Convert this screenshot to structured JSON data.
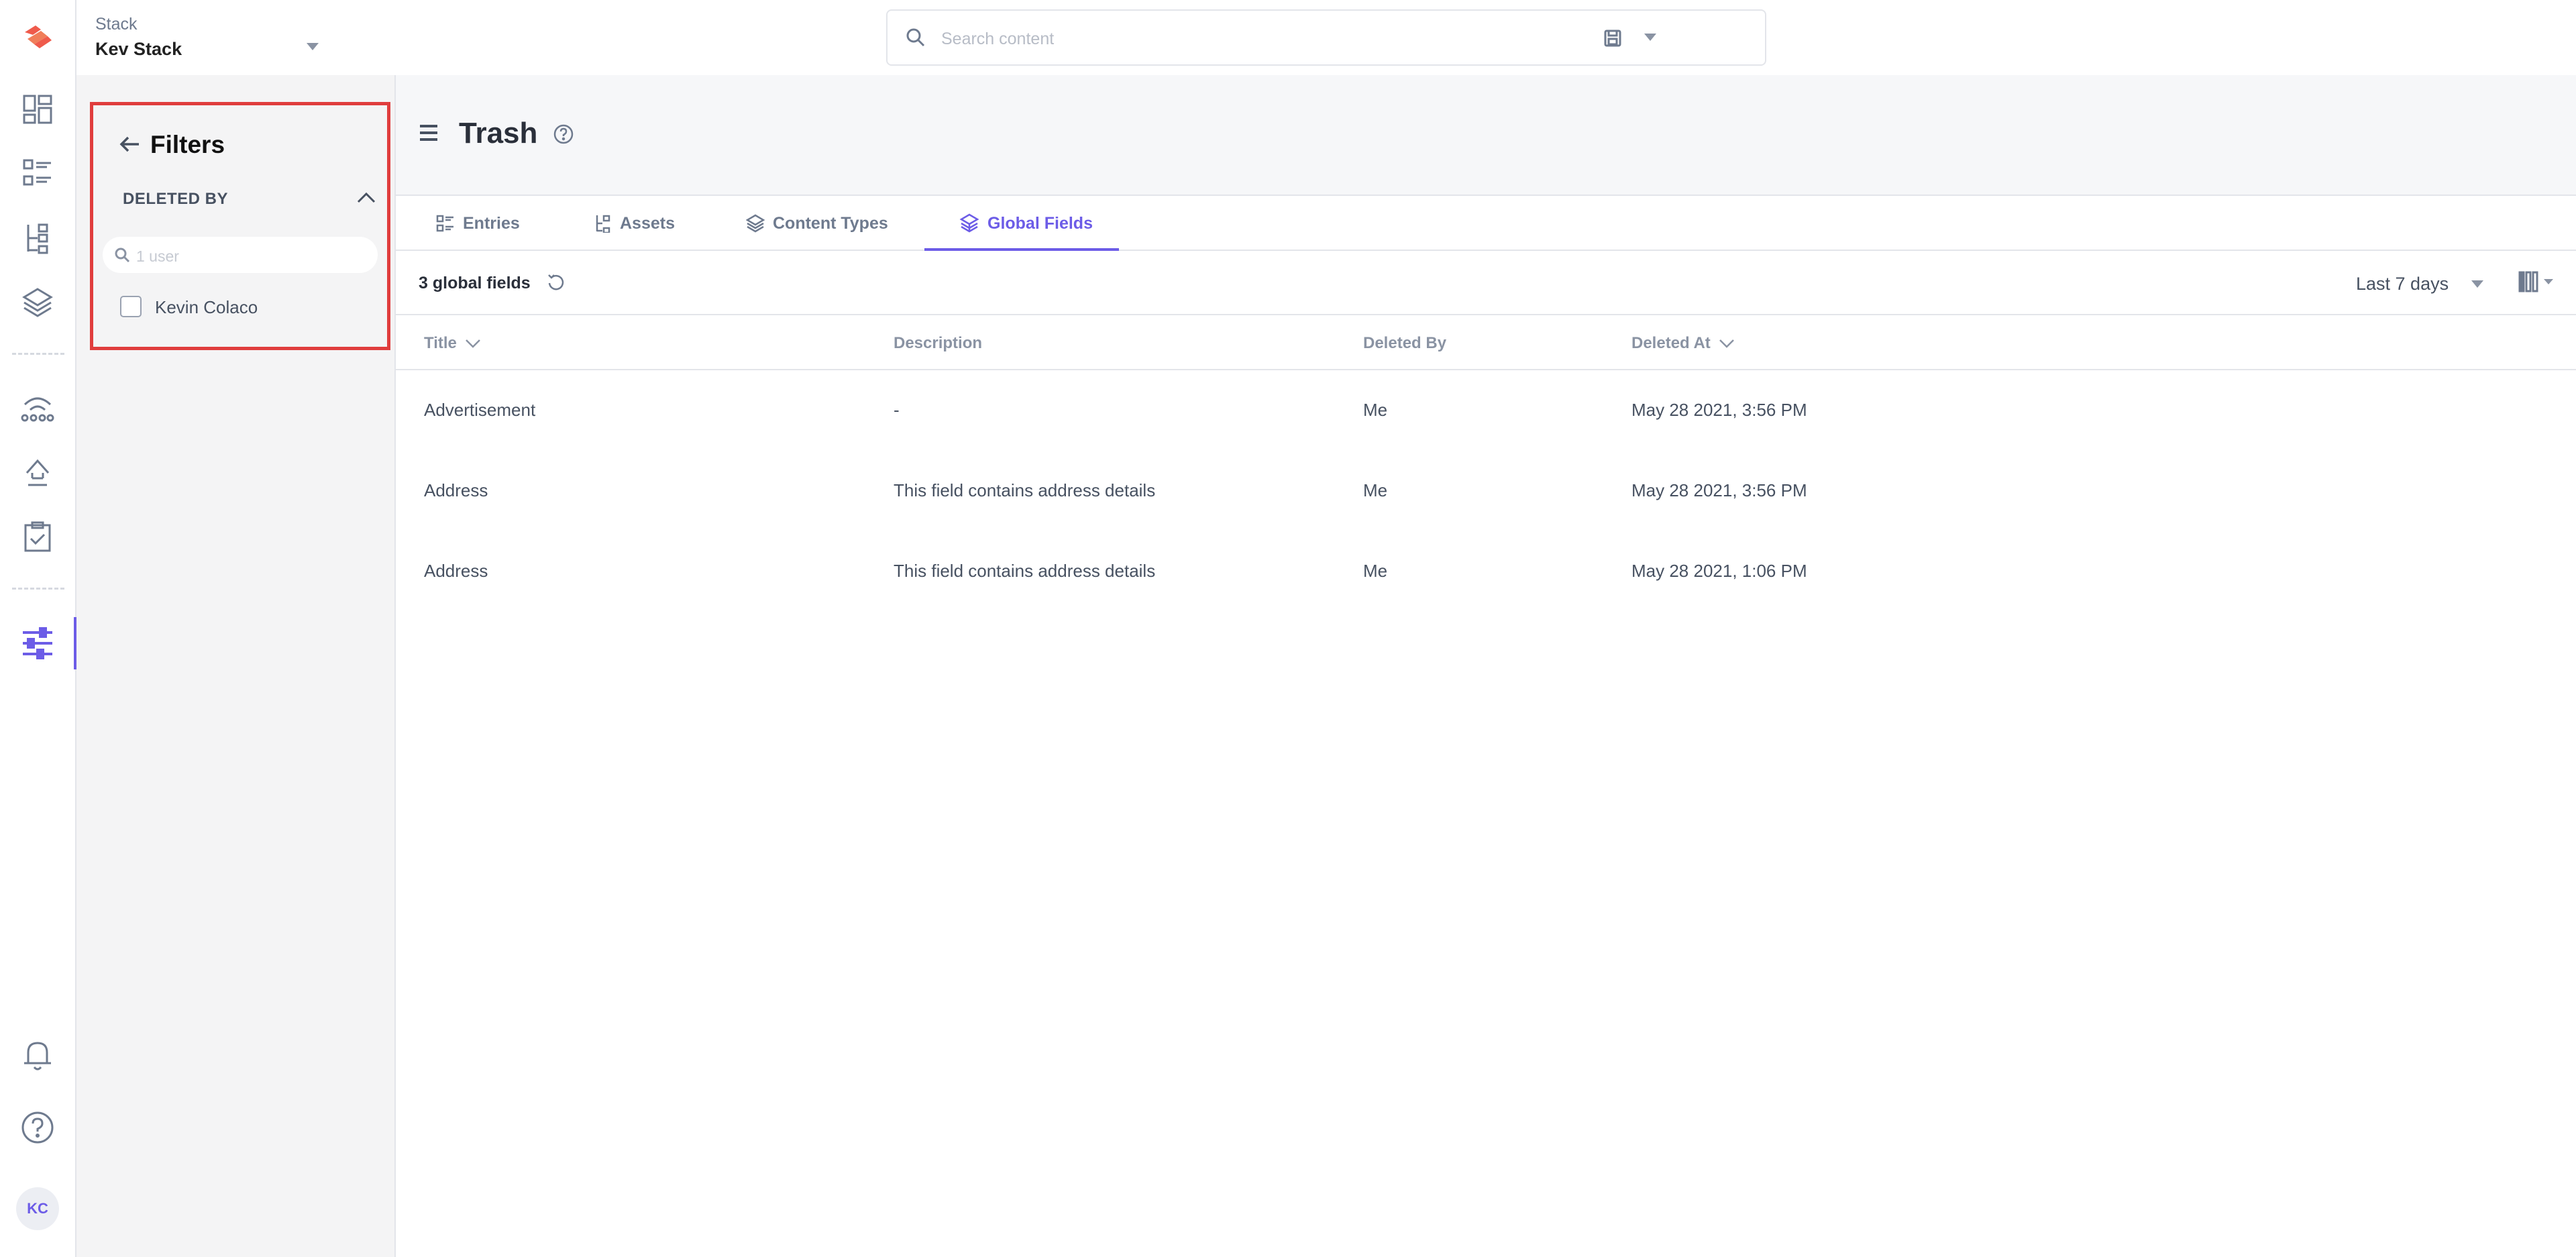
{
  "colors": {
    "accent": "#6c5ce7",
    "highlight_border": "#e03d3d",
    "logo": "#ef5b4c"
  },
  "stack": {
    "label": "Stack",
    "name": "Kev Stack"
  },
  "search": {
    "placeholder": "Search content"
  },
  "rail": {
    "items": [
      {
        "icon": "dashboard-icon"
      },
      {
        "icon": "entries-list-icon"
      },
      {
        "icon": "content-models-icon"
      },
      {
        "icon": "stack-layers-icon"
      },
      {
        "icon": "extensions-icon"
      },
      {
        "icon": "deploy-arrow-icon"
      },
      {
        "icon": "tasks-clipboard-icon"
      },
      {
        "icon": "settings-sliders-icon"
      },
      {
        "icon": "notifications-bell-icon"
      },
      {
        "icon": "help-circle-icon"
      }
    ],
    "avatar": "KC"
  },
  "filters": {
    "title": "Filters",
    "section": "DELETED BY",
    "search_placeholder": "1 user",
    "users": [
      "Kevin Colaco"
    ]
  },
  "page": {
    "title": "Trash"
  },
  "tabs": [
    {
      "label": "Entries",
      "icon": "entries-icon"
    },
    {
      "label": "Assets",
      "icon": "assets-icon"
    },
    {
      "label": "Content Types",
      "icon": "content-types-icon"
    },
    {
      "label": "Global Fields",
      "icon": "global-fields-icon",
      "active": true
    }
  ],
  "toolbar": {
    "count": "3 global fields",
    "range": "Last 7 days"
  },
  "table": {
    "columns": [
      "Title",
      "Description",
      "Deleted By",
      "Deleted At"
    ],
    "rows": [
      {
        "title": "Advertisement",
        "description": "-",
        "deleted_by": "Me",
        "deleted_at": "May 28 2021, 3:56 PM"
      },
      {
        "title": "Address",
        "description": "This field contains address details",
        "deleted_by": "Me",
        "deleted_at": "May 28 2021, 3:56 PM"
      },
      {
        "title": "Address",
        "description": "This field contains address details",
        "deleted_by": "Me",
        "deleted_at": "May 28 2021, 1:06 PM"
      }
    ]
  }
}
